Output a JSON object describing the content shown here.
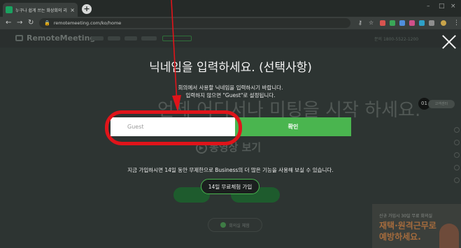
{
  "browser": {
    "tab_title": "누구나 쉽게 쓰는 화상회의 리모트미팅",
    "tab_close": "×",
    "new_tab": "+",
    "url": "remotemeeting.com/ko/home",
    "window_min": "–",
    "window_max": "□",
    "window_close": "×"
  },
  "site": {
    "logo": "RemoteMeeting",
    "header_right": "문의 1800-5522-1200",
    "bg_heading": "언제 어디서나 미팅을 시작 하세요.",
    "bg_video": "동영상 보기",
    "bg_small_button": "회의실 체험",
    "badge": "01",
    "side_pill": "고객센터",
    "promo_line1": "신규 가입시 30일 무료 회의실",
    "promo_line2": "재택·원격근무로",
    "promo_line3": "예방하세요."
  },
  "modal": {
    "title": "닉네임을 입력하세요. (선택사항)",
    "desc_line1": "회의에서 사용할 닉네임을 입력하시기 바랍니다.",
    "desc_line2": "입력하지 않으면 \"Guest\"로 설정됩니다.",
    "input_placeholder": "Guest",
    "confirm_label": "확인",
    "promo_text": "지금 가입하시면 14일 동안 무제한으로 Business의 더 많은 기능을 사용해 보실 수 있습니다.",
    "trial_label": "14일 무료체험 가입"
  },
  "colors": {
    "accent_green": "#4ab54f",
    "annotation_red": "#e0141a"
  }
}
